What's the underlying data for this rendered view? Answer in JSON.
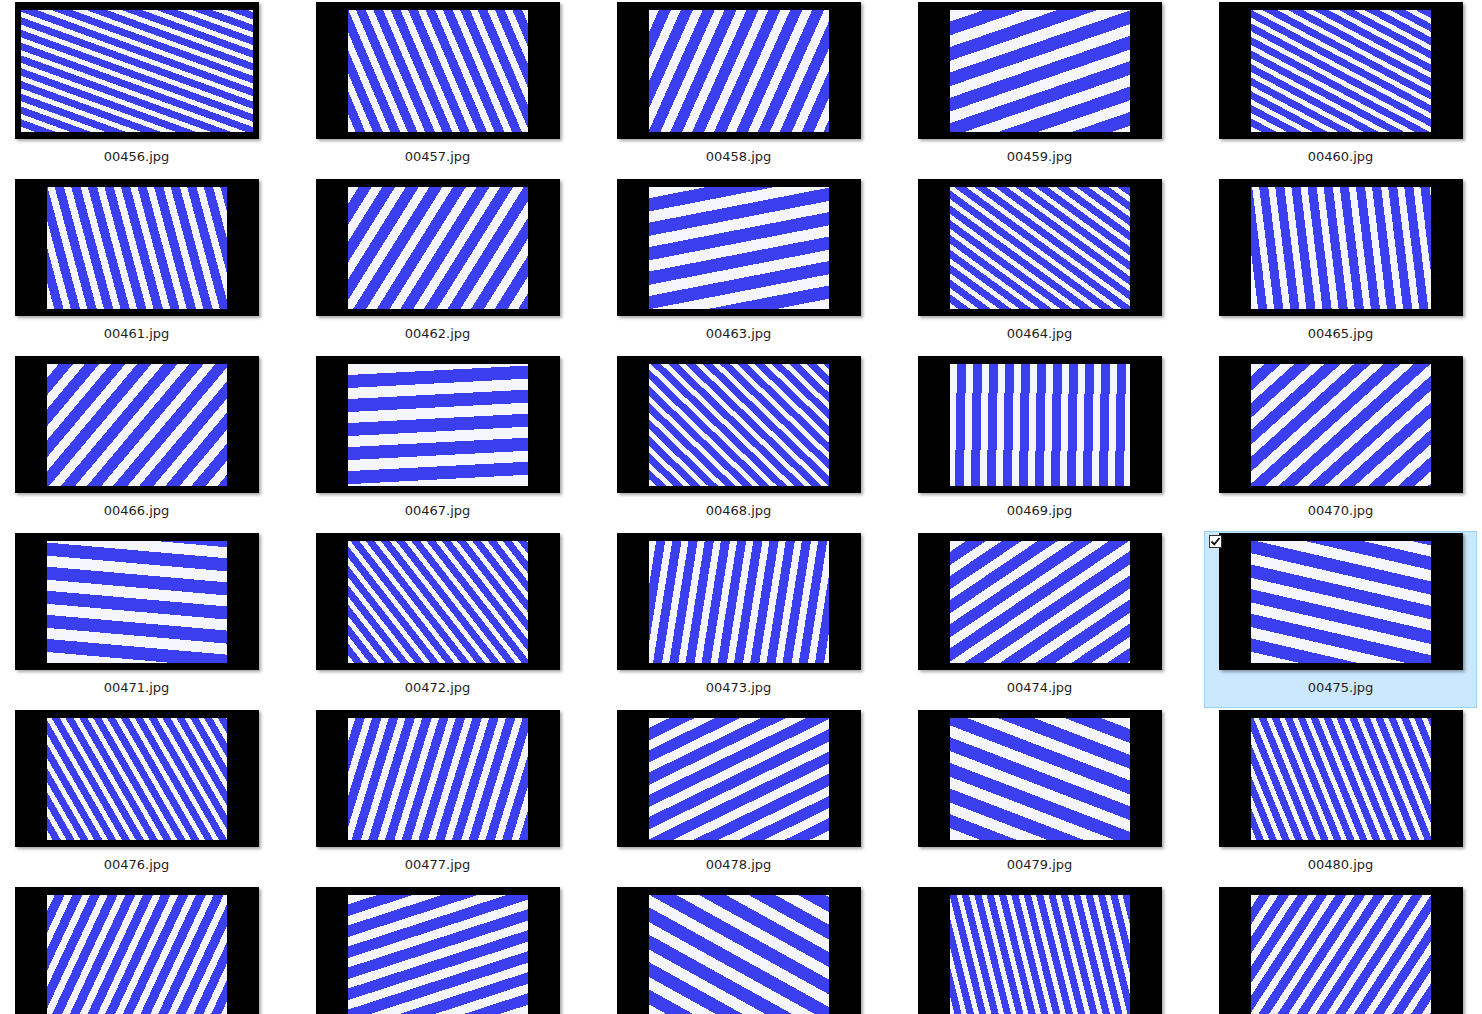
{
  "items": [
    {
      "name": "00456.jpg",
      "selected": false,
      "checked": false
    },
    {
      "name": "00457.jpg",
      "selected": false,
      "checked": false
    },
    {
      "name": "00458.jpg",
      "selected": false,
      "checked": false
    },
    {
      "name": "00459.jpg",
      "selected": false,
      "checked": false
    },
    {
      "name": "00460.jpg",
      "selected": false,
      "checked": false
    },
    {
      "name": "00461.jpg",
      "selected": false,
      "checked": false
    },
    {
      "name": "00462.jpg",
      "selected": false,
      "checked": false
    },
    {
      "name": "00463.jpg",
      "selected": false,
      "checked": false
    },
    {
      "name": "00464.jpg",
      "selected": false,
      "checked": false
    },
    {
      "name": "00465.jpg",
      "selected": false,
      "checked": false
    },
    {
      "name": "00466.jpg",
      "selected": false,
      "checked": false
    },
    {
      "name": "00467.jpg",
      "selected": false,
      "checked": false
    },
    {
      "name": "00468.jpg",
      "selected": false,
      "checked": false
    },
    {
      "name": "00469.jpg",
      "selected": false,
      "checked": false
    },
    {
      "name": "00470.jpg",
      "selected": false,
      "checked": false
    },
    {
      "name": "00471.jpg",
      "selected": false,
      "checked": false
    },
    {
      "name": "00472.jpg",
      "selected": false,
      "checked": false
    },
    {
      "name": "00473.jpg",
      "selected": false,
      "checked": false
    },
    {
      "name": "00474.jpg",
      "selected": false,
      "checked": false
    },
    {
      "name": "00475.jpg",
      "selected": true,
      "checked": true
    },
    {
      "name": "00476.jpg",
      "selected": false,
      "checked": false
    },
    {
      "name": "00477.jpg",
      "selected": false,
      "checked": false
    },
    {
      "name": "00478.jpg",
      "selected": false,
      "checked": false
    },
    {
      "name": "00479.jpg",
      "selected": false,
      "checked": false
    },
    {
      "name": "00480.jpg",
      "selected": false,
      "checked": false
    },
    {
      "name": "",
      "selected": false,
      "checked": false
    },
    {
      "name": "",
      "selected": false,
      "checked": false
    },
    {
      "name": "",
      "selected": false,
      "checked": false
    },
    {
      "name": "",
      "selected": false,
      "checked": false
    },
    {
      "name": "",
      "selected": false,
      "checked": false
    }
  ]
}
